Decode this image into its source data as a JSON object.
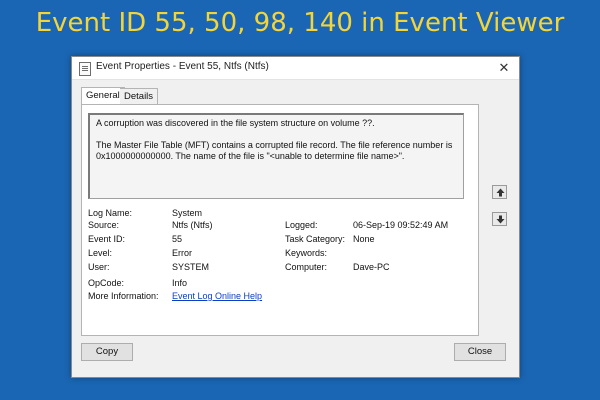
{
  "banner": {
    "title": "Event ID 55, 50, 98, 140 in Event Viewer"
  },
  "dialog": {
    "title": "Event Properties - Event 55, Ntfs (Ntfs)",
    "close_glyph": "✕",
    "tabs": [
      {
        "label": "General",
        "active": true
      },
      {
        "label": "Details",
        "active": false
      }
    ],
    "description": {
      "line1": "A corruption was discovered in the file system structure on volume ??.",
      "line2": "The Master File Table (MFT) contains a corrupted file record.  The file reference number is 0x1000000000000.  The name of the file is \"<unable to determine file name>\"."
    },
    "fields": {
      "log_name_label": "Log Name:",
      "log_name_value": "System",
      "source_label": "Source:",
      "source_value": "Ntfs (Ntfs)",
      "logged_label": "Logged:",
      "logged_value": "06-Sep-19 09:52:49 AM",
      "event_id_label": "Event ID:",
      "event_id_value": "55",
      "task_category_label": "Task Category:",
      "task_category_value": "None",
      "level_label": "Level:",
      "level_value": "Error",
      "keywords_label": "Keywords:",
      "keywords_value": "",
      "user_label": "User:",
      "user_value": "SYSTEM",
      "computer_label": "Computer:",
      "computer_value": "Dave-PC",
      "opcode_label": "OpCode:",
      "opcode_value": "Info",
      "more_info_label": "More Information:",
      "more_info_link": "Event Log Online Help"
    },
    "buttons": {
      "copy": "Copy",
      "close": "Close"
    },
    "nav": {
      "up_icon": "arrow-up-icon",
      "down_icon": "arrow-down-icon"
    }
  },
  "colors": {
    "background": "#1a66b4",
    "banner_text": "#f3d53a",
    "link": "#0b3fc6"
  }
}
